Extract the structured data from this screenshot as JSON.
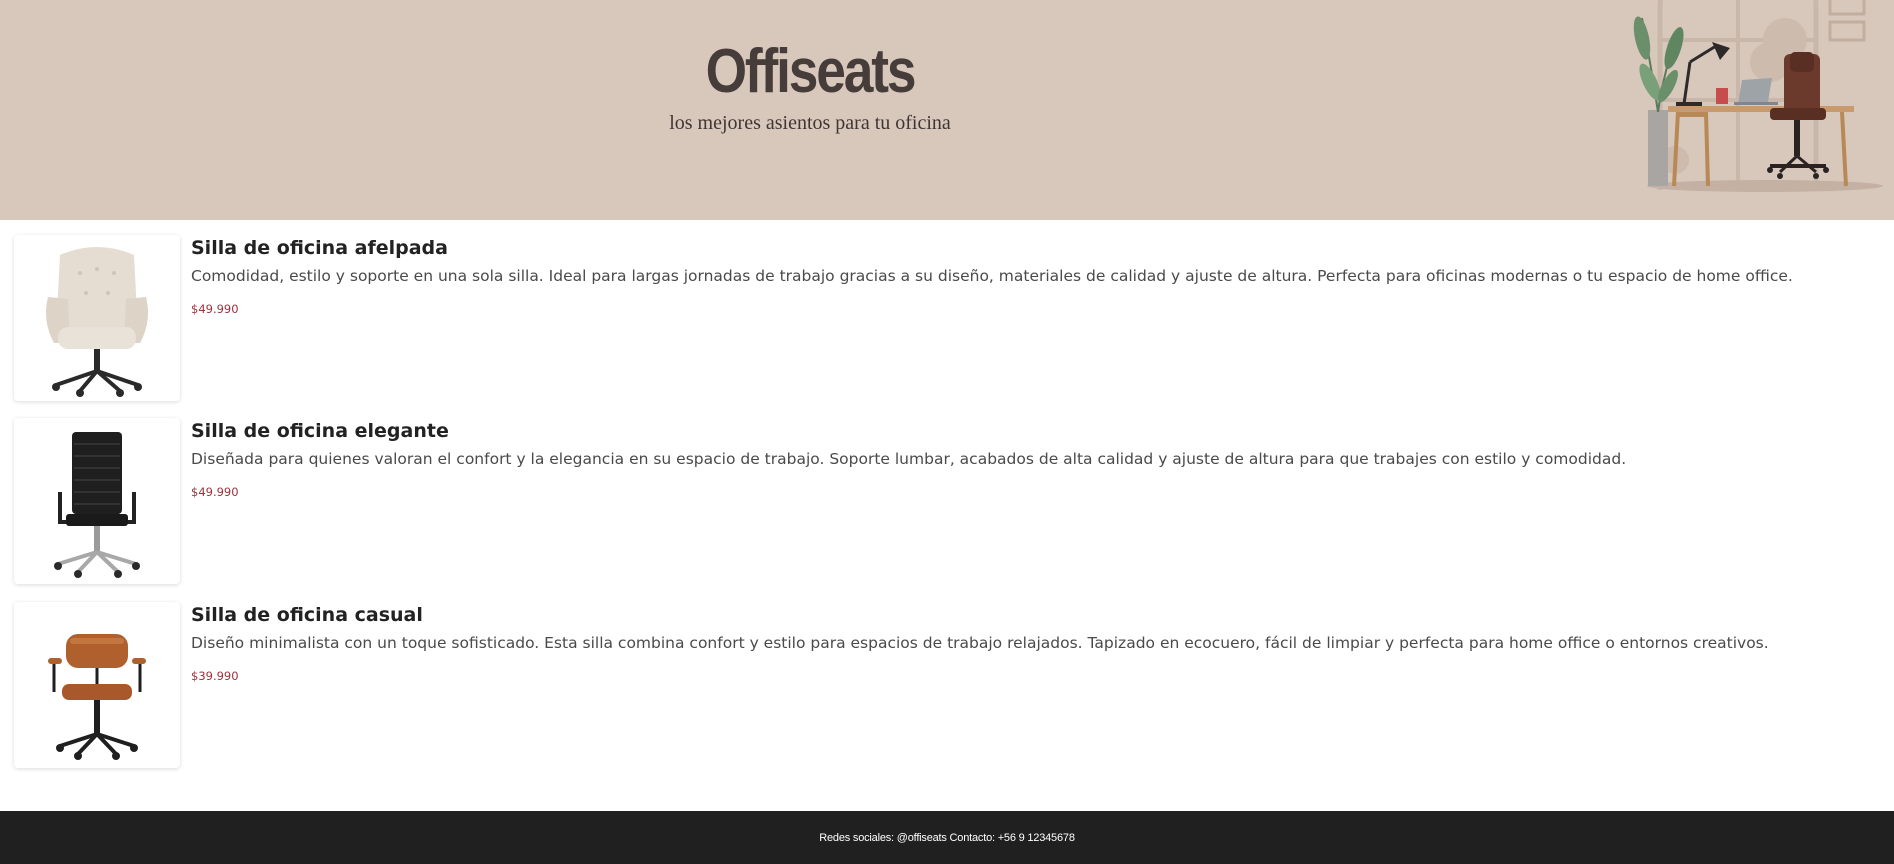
{
  "header": {
    "title": "Offiseats",
    "subtitle": "los mejores asientos para tu oficina",
    "illustration_icon": "office-desk-illustration"
  },
  "products": [
    {
      "name": "Silla de oficina afelpada",
      "description": "Comodidad, estilo y soporte en una sola silla. Ideal para largas jornadas de trabajo gracias a su diseño, materiales de calidad y ajuste de altura. Perfecta para oficinas modernas o tu espacio de home office.",
      "price": "$49.990",
      "image_icon": "beige-armchair-image"
    },
    {
      "name": "Silla de oficina elegante",
      "description": "Diseñada para quienes valoran el confort y la elegancia en su espacio de trabajo. Soporte lumbar, acabados de alta calidad y ajuste de altura para que trabajes con estilo y comodidad.",
      "price": "$49.990",
      "image_icon": "black-executive-chair-image"
    },
    {
      "name": "Silla de oficina casual",
      "description": "Diseño minimalista con un toque sofisticado. Esta silla combina confort y estilo para espacios de trabajo relajados. Tapizado en ecocuero, fácil de limpiar y perfecta para home office o entornos creativos.",
      "price": "$39.990",
      "image_icon": "brown-leather-chair-image"
    }
  ],
  "footer": {
    "text": "Redes sociales: @offiseats Contacto: +56 9 12345678"
  },
  "colors": {
    "header_bg": "#d8c8bc",
    "title": "#463c3a",
    "price": "#a2313d",
    "footer_bg": "#202020"
  }
}
